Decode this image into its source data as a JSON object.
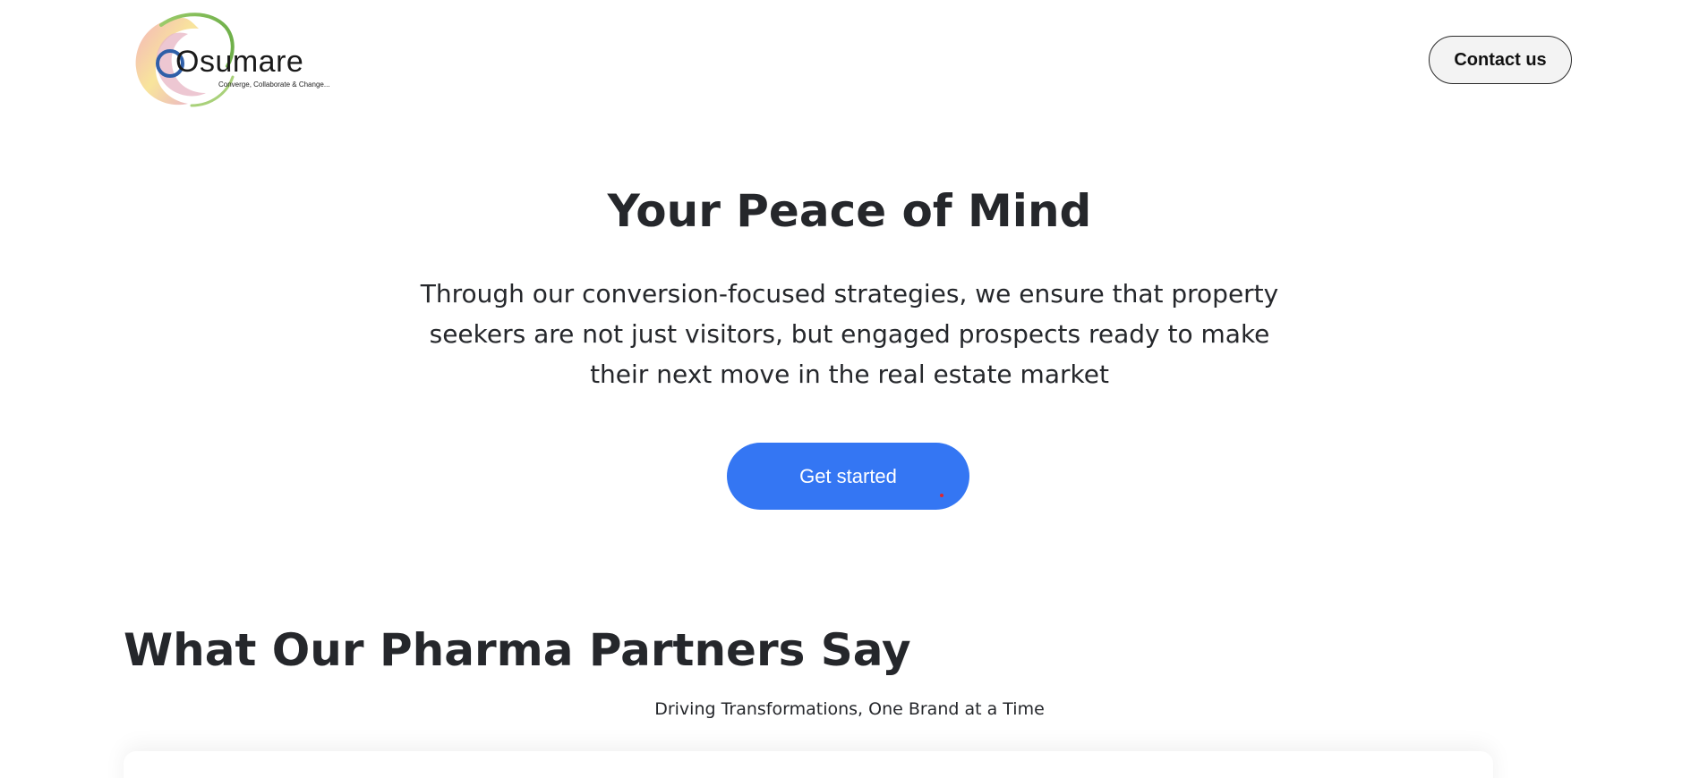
{
  "header": {
    "logo": {
      "wordmark": "Osumare",
      "tagline": "Converge, Collaborate & Change..."
    },
    "contact_label": "Contact us"
  },
  "hero": {
    "title": "Your Peace of Mind",
    "text": "Through our conversion-focused strategies, we ensure that property seekers are not just visitors, but engaged prospects ready to make their next move in the real estate market",
    "cta_label": "Get started"
  },
  "testimonials": {
    "title": "What Our Pharma Partners Say",
    "subtitle": "Driving Transformations, One Brand at a Time"
  },
  "colors": {
    "accent": "#3476f3",
    "text": "#25272b",
    "cursor": "#e0262d"
  }
}
